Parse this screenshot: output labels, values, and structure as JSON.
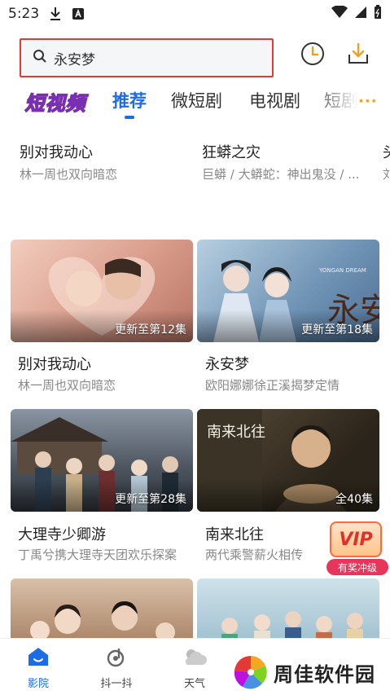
{
  "status_bar": {
    "time": "5:23"
  },
  "search": {
    "query": "永安梦"
  },
  "tabs": {
    "logo_label": "短视频",
    "items": [
      "推荐",
      "微短剧",
      "电视剧",
      "短剧"
    ],
    "more": "···"
  },
  "top_row": [
    {
      "title": "别对我动心",
      "subtitle": "林一周也双向暗恋"
    },
    {
      "title": "狂蟒之灾",
      "subtitle": "巨蟒 / 大蟒蛇：神出鬼没 / ..."
    },
    {
      "title": "头",
      "subtitle": "刘"
    }
  ],
  "cards": [
    {
      "title": "别对我动心",
      "subtitle": "林一周也双向暗恋",
      "badge": "更新至第12集",
      "thumb_color": "#e8b8a6"
    },
    {
      "title": "永安梦",
      "subtitle": "欧阳娜娜徐正溪揭梦定情",
      "badge": "更新至第18集",
      "thumb_color": "#7fa6c4",
      "poster_text": "永安梦",
      "poster_sub": "YONGAN DREAM"
    },
    {
      "title": "大理寺少卿游",
      "subtitle": "丁禹兮携大理寺天团欢乐探案",
      "badge": "更新至第28集",
      "thumb_color": "#5c6470"
    },
    {
      "title": "南来北往",
      "subtitle": "两代乘警薪火相传",
      "badge": "全40集",
      "thumb_color": "#3e3628",
      "poster_text": "南来北往"
    },
    {
      "title": "",
      "subtitle": "",
      "badge": "",
      "thumb_color": "#caa98a"
    },
    {
      "title": "",
      "subtitle": "",
      "badge": "",
      "thumb_color": "#bcd4df"
    }
  ],
  "vip": {
    "label": "VIP",
    "tag": "有奖冲级"
  },
  "bottom_nav": [
    {
      "label": "影院",
      "icon": "home-icon",
      "active": true
    },
    {
      "label": "抖一抖",
      "icon": "shake-icon",
      "active": false
    },
    {
      "label": "天气",
      "icon": "weather-icon",
      "active": false
    }
  ],
  "watermark": {
    "text": "周佳软件园"
  },
  "colors": {
    "accent": "#1e6be6",
    "highlight": "#e53935",
    "icon_orange": "#f0a020"
  }
}
